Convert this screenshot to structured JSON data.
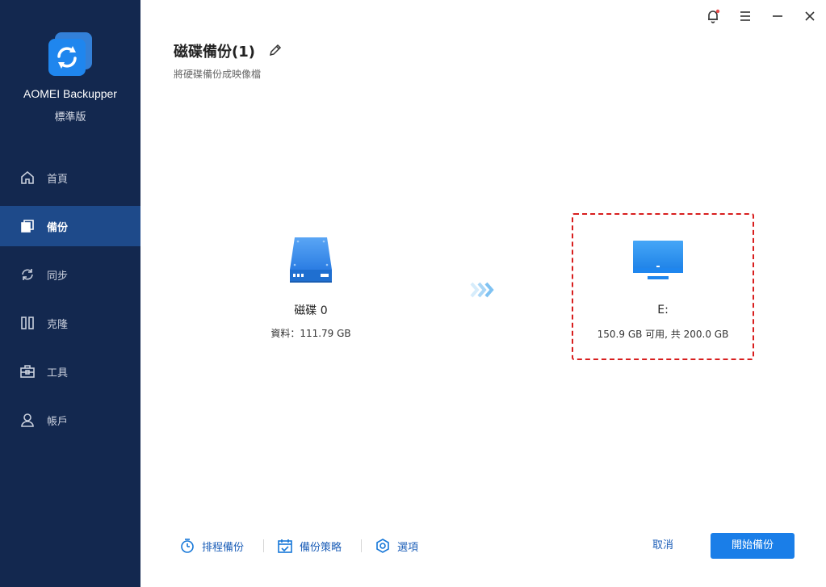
{
  "app": {
    "name": "AOMEI Backupper",
    "edition": "標準版"
  },
  "sidebar": {
    "items": [
      {
        "label": "首頁",
        "icon": "home-icon",
        "active": false
      },
      {
        "label": "備份",
        "icon": "backup-icon",
        "active": true
      },
      {
        "label": "同步",
        "icon": "sync-icon",
        "active": false
      },
      {
        "label": "克隆",
        "icon": "clone-icon",
        "active": false
      },
      {
        "label": "工具",
        "icon": "tools-icon",
        "active": false
      },
      {
        "label": "帳戶",
        "icon": "account-icon",
        "active": false
      }
    ]
  },
  "window_controls": [
    "bell-icon",
    "menu-icon",
    "minimize-icon",
    "close-icon"
  ],
  "header": {
    "title": "磁碟備份(1)",
    "subtitle": "將硬碟備份成映像檔"
  },
  "source": {
    "name": "磁碟 0",
    "info": "資料：111.79 GB"
  },
  "destination": {
    "name": "E:",
    "info": "150.9 GB 可用, 共 200.0 GB"
  },
  "footer": {
    "schedule_label": "排程備份",
    "scheme_label": "備份策略",
    "options_label": "選項",
    "cancel_label": "取消",
    "start_label": "開始備份"
  },
  "colors": {
    "sidebar_bg": "#13284f",
    "sidebar_active": "#1e4a8a",
    "accent": "#1a7ee8",
    "highlight_border": "#d81e1e",
    "notification_dot": "#e94b4b"
  }
}
